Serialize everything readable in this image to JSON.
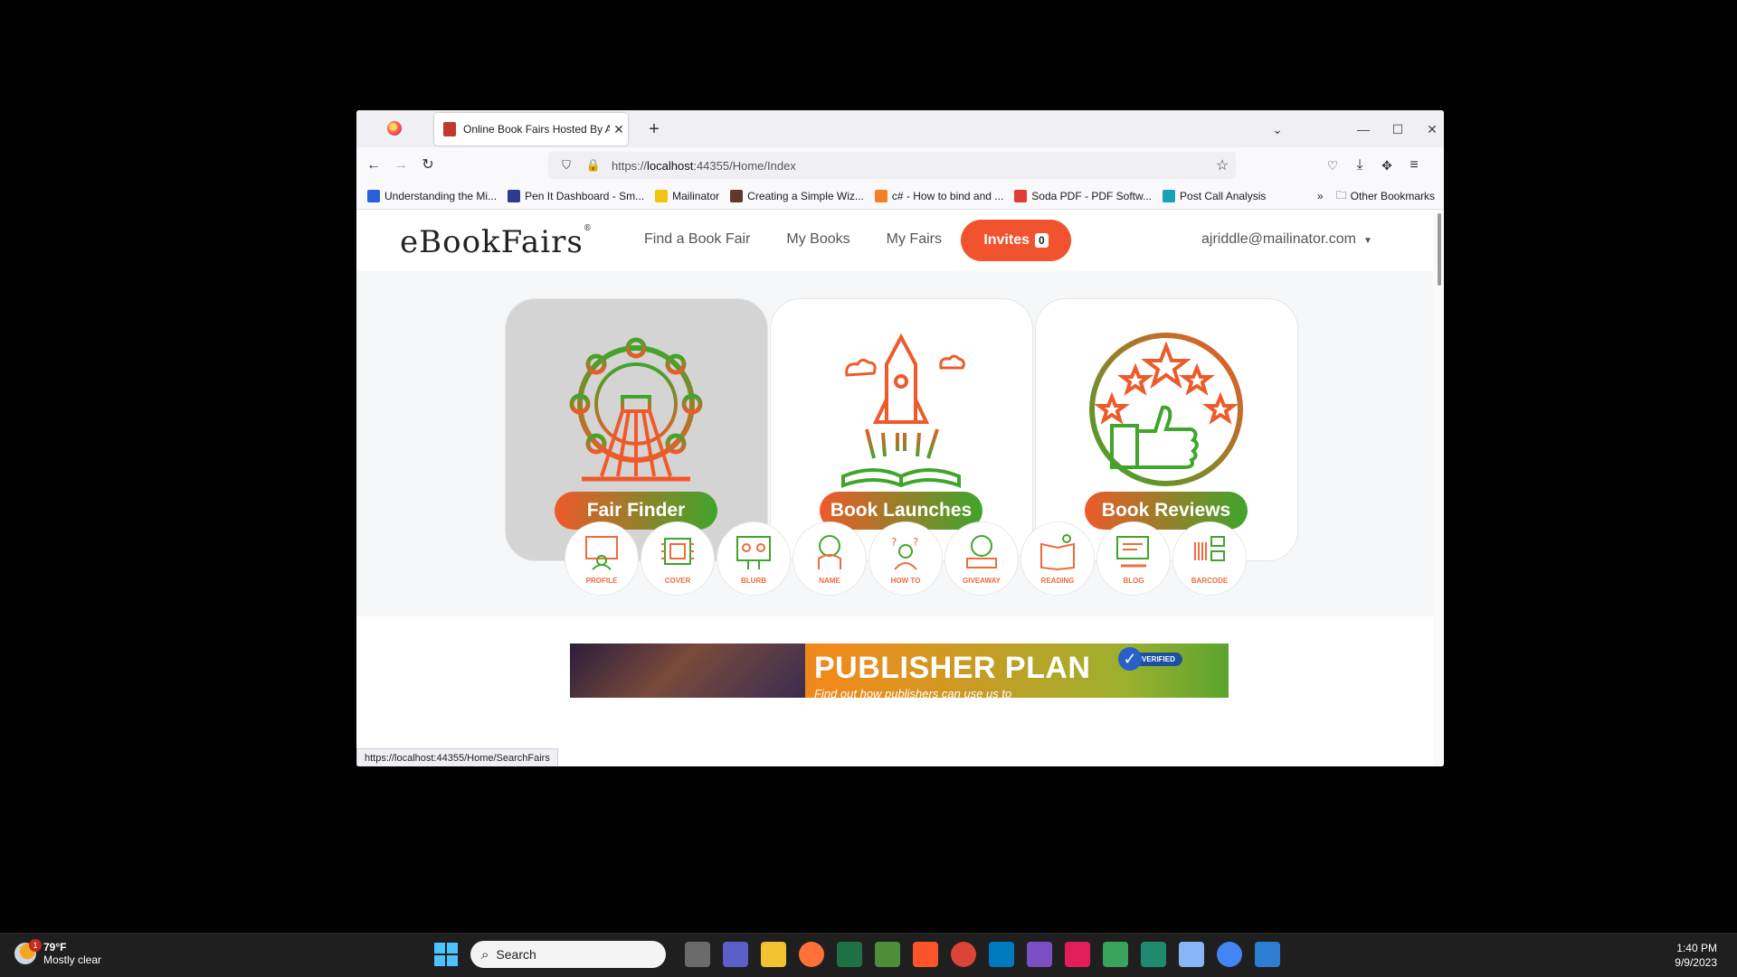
{
  "browser": {
    "tab_title": "Online Book Fairs Hosted By A",
    "url_prefix": "https://",
    "url_host": "localhost",
    "url_rest": ":44355/Home/Index",
    "bookmarks": [
      {
        "label": "Understanding the Mi...",
        "color": "#2b5fd9"
      },
      {
        "label": "Pen It Dashboard - Sm...",
        "color": "#2e3a8c"
      },
      {
        "label": "Mailinator",
        "color": "#f1c40f"
      },
      {
        "label": "Creating a Simple Wiz...",
        "color": "#5b3a2b"
      },
      {
        "label": "c# - How to bind and ...",
        "color": "#f48024"
      },
      {
        "label": "Soda PDF - PDF Softw...",
        "color": "#e03c31"
      },
      {
        "label": "Post Call Analysis",
        "color": "#17a2b8"
      }
    ],
    "other_bookmarks": "Other Bookmarks",
    "status_url": "https://localhost:44355/Home/SearchFairs"
  },
  "site": {
    "logo_text": "eBookFairs",
    "nav": [
      "Find a Book Fair",
      "My Books",
      "My Fairs"
    ],
    "invites_label": "Invites",
    "invites_count": "0",
    "user_email": "ajriddle@mailinator.com"
  },
  "cards": [
    {
      "label": "Fair Finder",
      "icon": "ferris-wheel-icon",
      "active": true
    },
    {
      "label": "Book Launches",
      "icon": "rocket-book-icon",
      "active": false
    },
    {
      "label": "Book Reviews",
      "icon": "thumbs-up-stars-icon",
      "active": false
    }
  ],
  "tools": [
    "PROFILE",
    "COVER",
    "BLURB",
    "NAME",
    "HOW TO",
    "GIVEAWAY",
    "READING",
    "BLOG",
    "BARCODE"
  ],
  "banner": {
    "title": "PUBLISHER PLAN",
    "subtitle": "Find out how publishers can use us to",
    "badge": "VERIFIED"
  },
  "taskbar": {
    "temperature": "79°F",
    "weather": "Mostly clear",
    "weather_badge": "1",
    "search_placeholder": "Search",
    "time": "1:40 PM",
    "date": "9/9/2023"
  },
  "colors": {
    "accent": "#f0532d",
    "green": "#3fa52b",
    "orange": "#ee5a2a"
  }
}
